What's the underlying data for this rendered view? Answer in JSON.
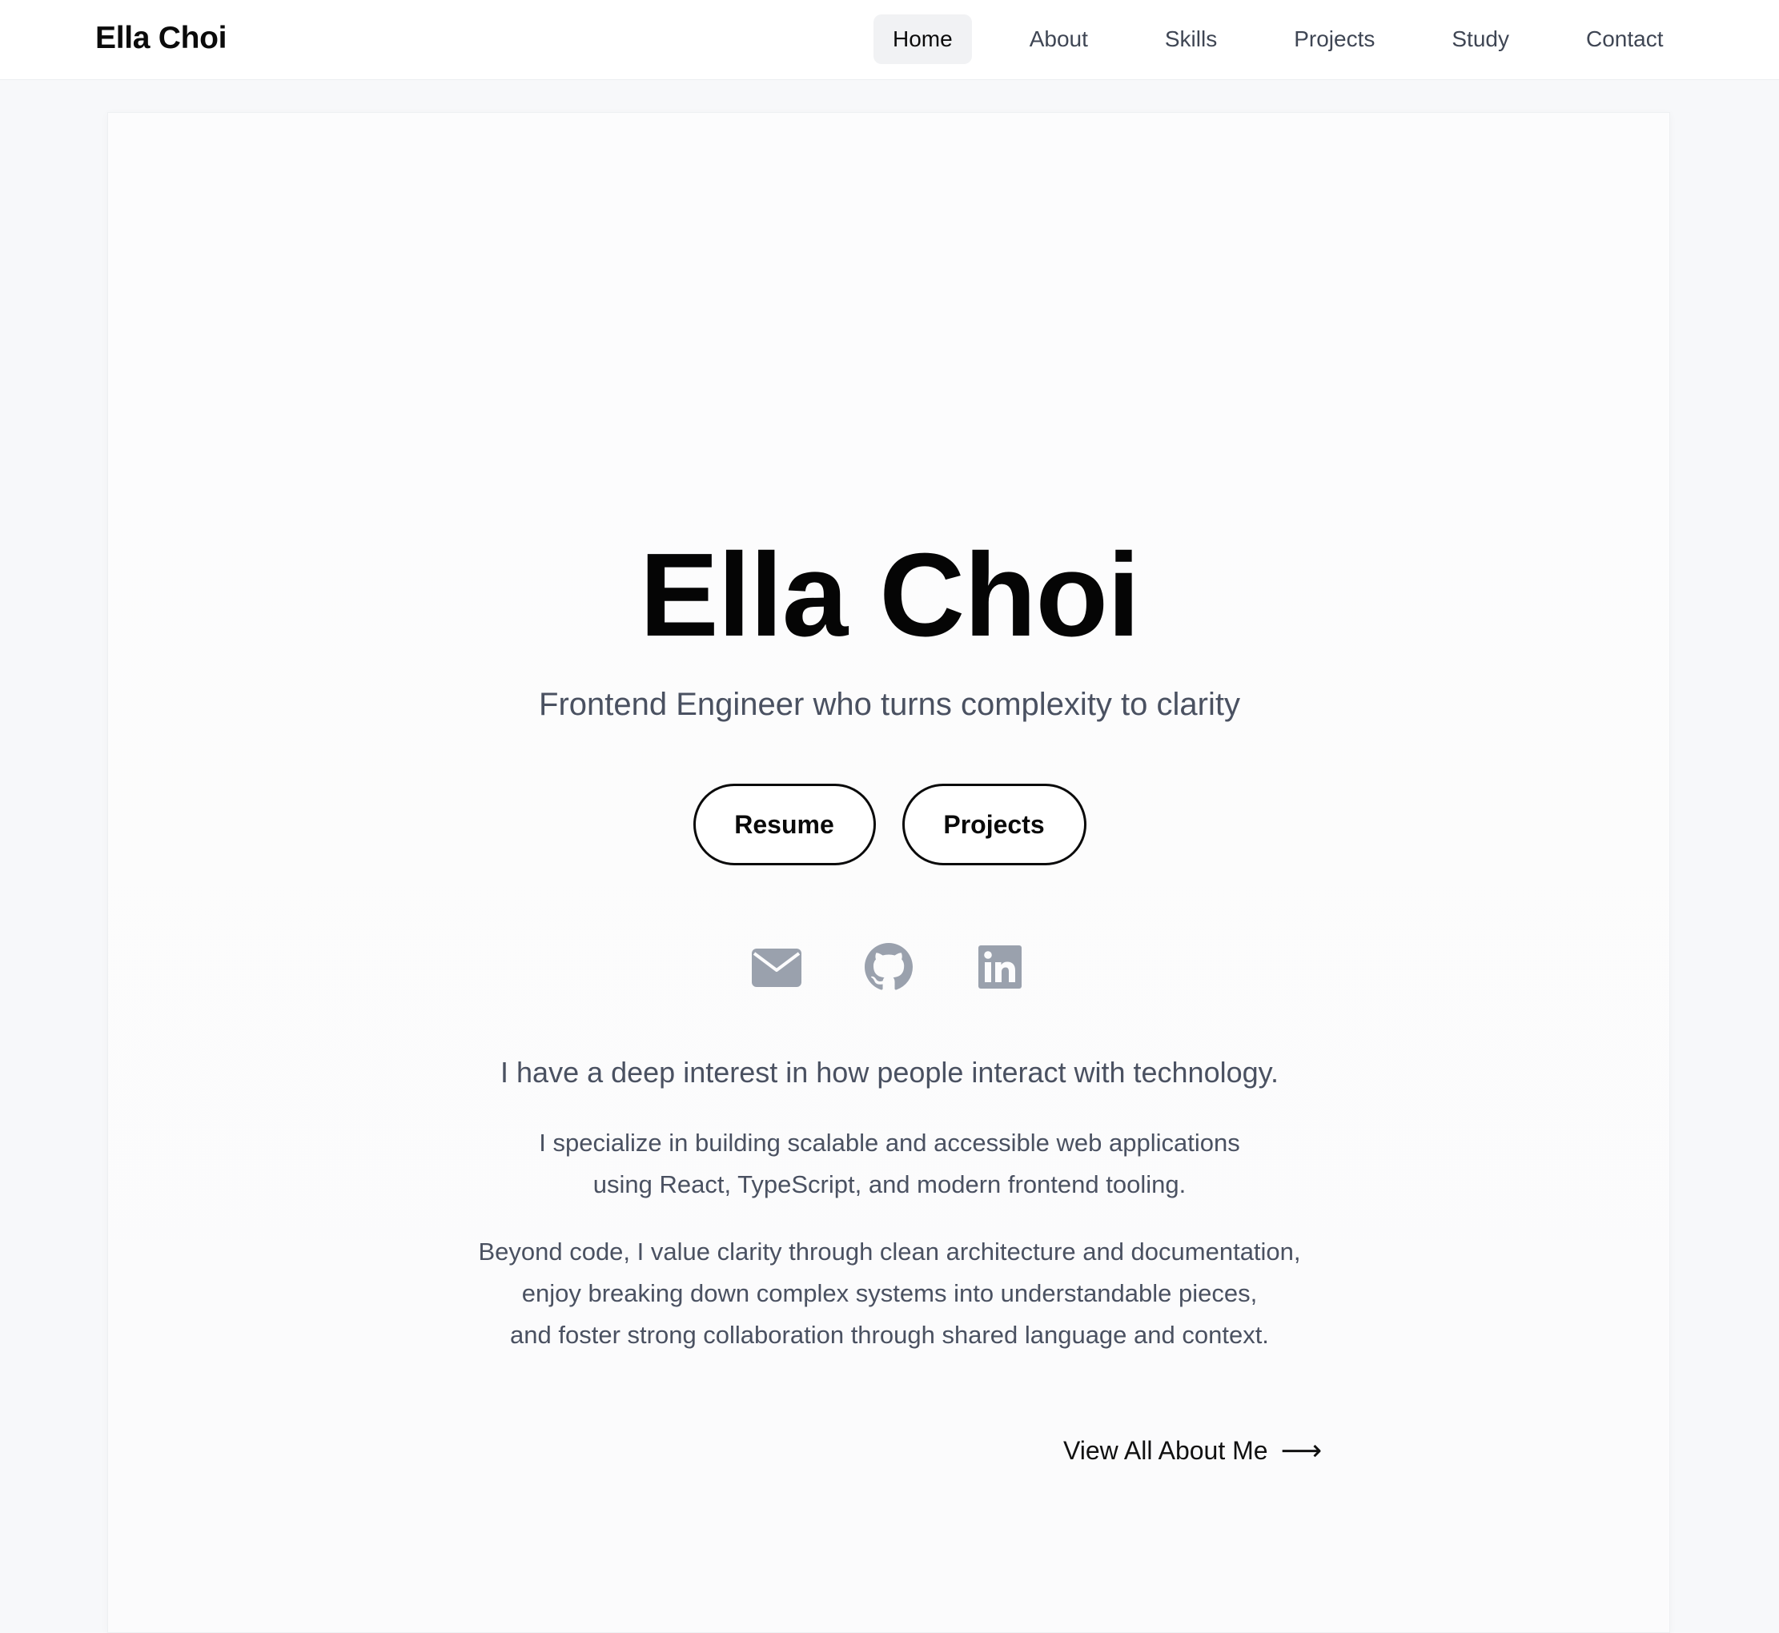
{
  "header": {
    "brand": "Ella Choi",
    "nav": [
      {
        "label": "Home",
        "active": true
      },
      {
        "label": "About",
        "active": false
      },
      {
        "label": "Skills",
        "active": false
      },
      {
        "label": "Projects",
        "active": false
      },
      {
        "label": "Study",
        "active": false
      },
      {
        "label": "Contact",
        "active": false
      }
    ]
  },
  "hero": {
    "title": "Ella Choi",
    "subtitle": "Frontend Engineer who turns complexity to clarity",
    "buttons": {
      "resume": "Resume",
      "projects": "Projects"
    },
    "social_icons": [
      "mail-icon",
      "github-icon",
      "linkedin-icon"
    ]
  },
  "about": {
    "lead": "I have a deep interest in how people interact with technology.",
    "paragraph1": [
      "I specialize in building scalable and accessible web applications",
      "using React, TypeScript, and modern frontend tooling."
    ],
    "paragraph2": [
      "Beyond code, I value clarity through clean architecture and documentation,",
      "enjoy breaking down complex systems into understandable pieces,",
      "and foster strong collaboration through shared language and context."
    ],
    "view_all": "View All About Me",
    "view_all_arrow": "⟶"
  },
  "colors": {
    "page_bg": "#f7f8fa",
    "card_bg": "#fcfcfd",
    "icon_gray": "#9aa1ad",
    "text_muted": "#4a5161",
    "active_nav_bg": "#f1f2f4"
  }
}
